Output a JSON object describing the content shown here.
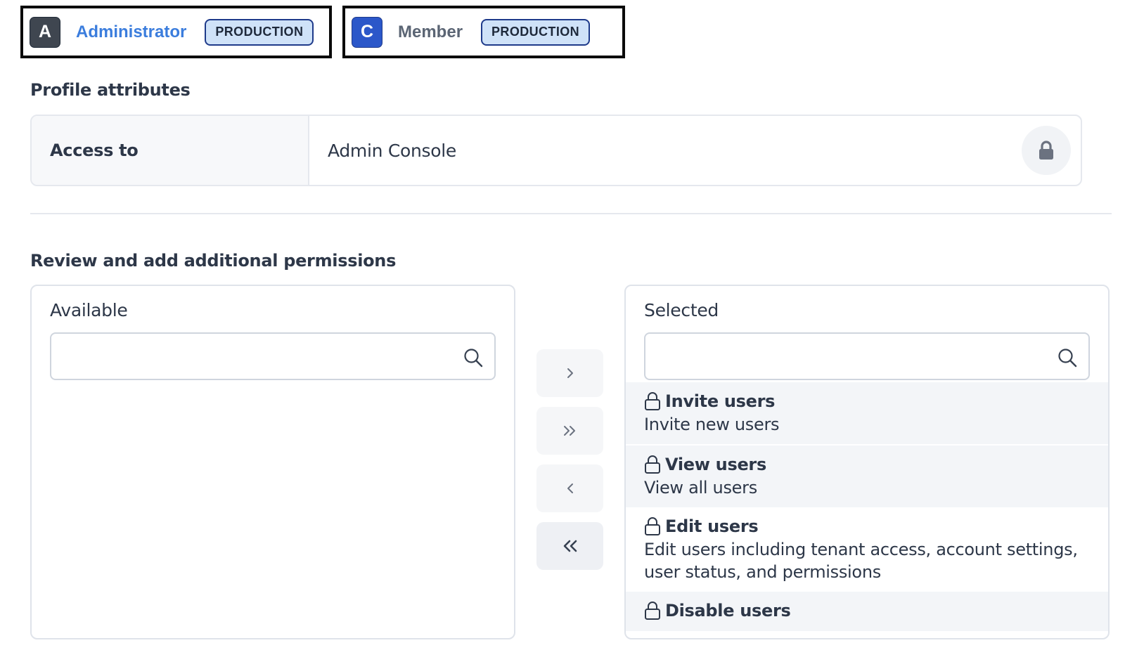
{
  "roles": [
    {
      "avatar": "A",
      "name": "Administrator",
      "badge": "PRODUCTION",
      "active": true
    },
    {
      "avatar": "C",
      "name": "Member",
      "badge": "PRODUCTION",
      "active": false
    }
  ],
  "profile": {
    "heading": "Profile attributes",
    "attribute_key": "Access to",
    "attribute_value": "Admin Console",
    "lock_icon": "lock-icon"
  },
  "permissions": {
    "heading": "Review and add additional permissions",
    "available": {
      "label": "Available",
      "search_value": "",
      "items": []
    },
    "selected": {
      "label": "Selected",
      "search_value": "",
      "items": [
        {
          "title": "Invite users",
          "description": "Invite new users"
        },
        {
          "title": "View users",
          "description": "View all users"
        },
        {
          "title": "Edit users",
          "description": "Edit users including tenant access, account settings, user status, and permissions"
        },
        {
          "title": "Disable users",
          "description": ""
        }
      ]
    },
    "move_buttons": [
      {
        "icon": "chevron-right-icon",
        "action": "add-selected"
      },
      {
        "icon": "double-chevron-right-icon",
        "action": "add-all"
      },
      {
        "icon": "chevron-left-icon",
        "action": "remove-selected"
      },
      {
        "icon": "double-chevron-left-icon",
        "action": "remove-all"
      }
    ]
  },
  "colors": {
    "admin_accent": "#3b7ddd",
    "badge_bg": "#cfe2f8",
    "member_avatar": "#2b57c9"
  }
}
